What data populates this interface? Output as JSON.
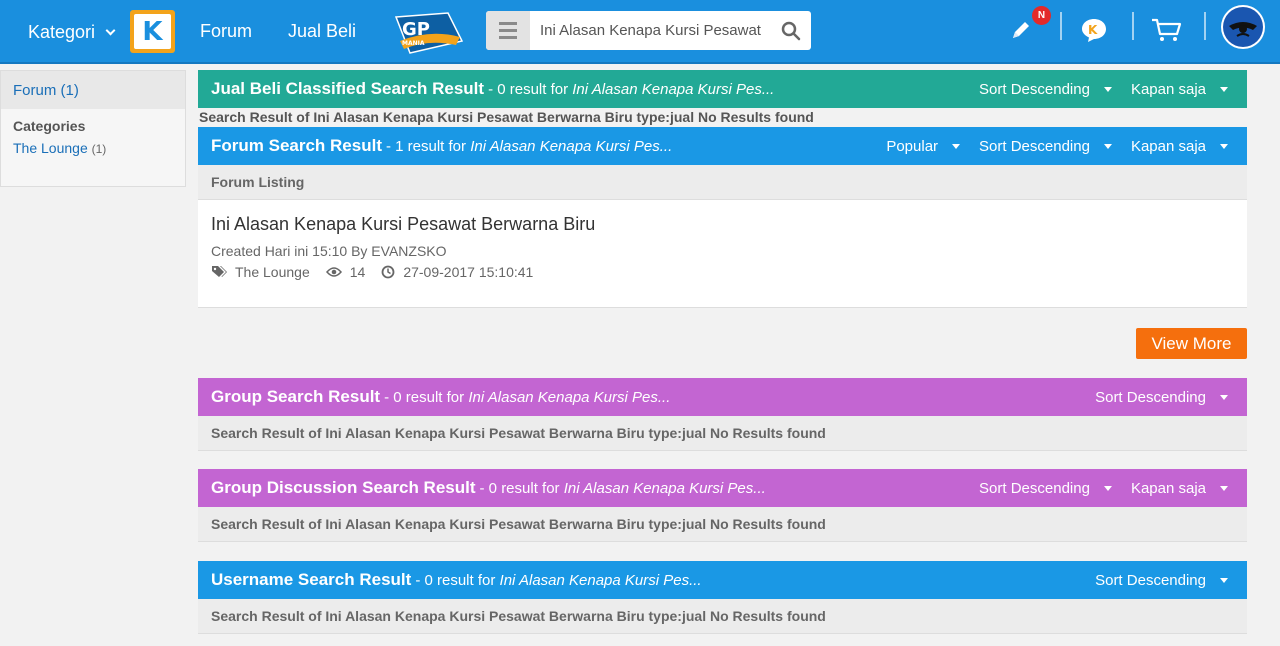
{
  "topbar": {
    "kategori_label": "Kategori",
    "nav": [
      "Forum",
      "Jual Beli"
    ],
    "search_value": "Ini Alasan Kenapa Kursi Pesawat",
    "notification_badge": "N",
    "brand_color": "#1a8fde"
  },
  "sidebar": {
    "forum_label": "Forum (1)",
    "categories_title": "Categories",
    "category_name": "The Lounge",
    "category_count": "(1)"
  },
  "sections": {
    "jualbeli": {
      "title": "Jual Beli Classified Search Result",
      "sub_prefix": "- 0 result for",
      "sub_query": "Ini Alasan Kenapa Kursi Pes...",
      "sort": "Sort Descending",
      "time": "Kapan saja",
      "noresult": "Search Result of Ini Alasan Kenapa Kursi Pesawat Berwarna Biru type:jual No Results found"
    },
    "forum": {
      "title": "Forum Search Result",
      "sub_prefix": "- 1 result for",
      "sub_query": "Ini Alasan Kenapa Kursi Pes...",
      "popular": "Popular",
      "sort": "Sort Descending",
      "time": "Kapan saja",
      "listing_label": "Forum Listing",
      "post": {
        "title": "Ini Alasan Kenapa Kursi Pesawat Berwarna Biru",
        "meta": "Created Hari ini 15:10 By EVANZSKO",
        "category": "The Lounge",
        "views": "14",
        "datetime": "27-09-2017 15:10:41"
      },
      "view_more": "View More"
    },
    "group": {
      "title": "Group Search Result",
      "sub_prefix": "- 0 result for",
      "sub_query": "Ini Alasan Kenapa Kursi Pes...",
      "sort": "Sort Descending",
      "noresult": "Search Result of Ini Alasan Kenapa Kursi Pesawat Berwarna Biru type:jual No Results found"
    },
    "group_discussion": {
      "title": "Group Discussion Search Result",
      "sub_prefix": "- 0 result for",
      "sub_query": "Ini Alasan Kenapa Kursi Pes...",
      "sort": "Sort Descending",
      "time": "Kapan saja",
      "noresult": "Search Result of Ini Alasan Kenapa Kursi Pesawat Berwarna Biru type:jual No Results found"
    },
    "username": {
      "title": "Username Search Result",
      "sub_prefix": "- 0 result for",
      "sub_query": "Ini Alasan Kenapa Kursi Pes...",
      "sort": "Sort Descending",
      "noresult": "Search Result of Ini Alasan Kenapa Kursi Pesawat Berwarna Biru type:jual No Results found"
    }
  },
  "colors": {
    "jualbeli_header": "#22a996",
    "forum_header": "#1a98e5",
    "group_header": "#c365d2",
    "view_more": "#f56f0d"
  }
}
